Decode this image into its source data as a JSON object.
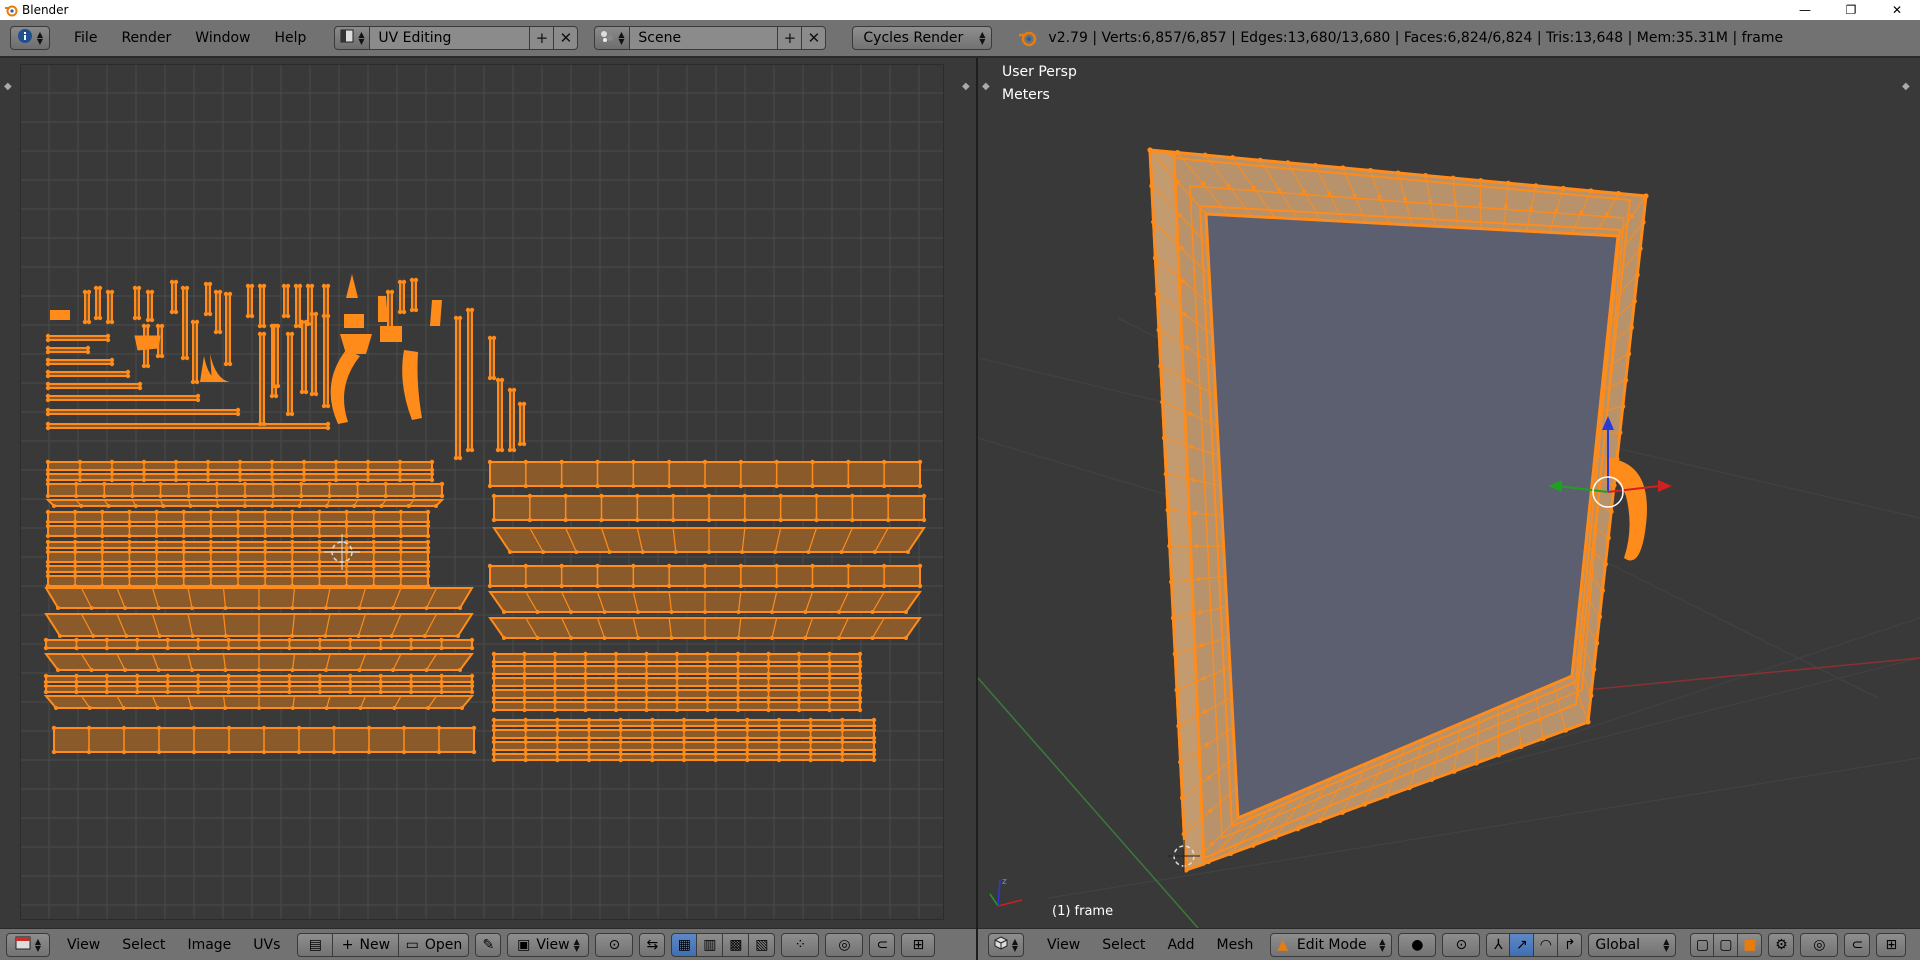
{
  "window": {
    "title": "Blender",
    "minimize": "—",
    "maximize": "❐",
    "close": "✕"
  },
  "info_header": {
    "menu": [
      "File",
      "Render",
      "Window",
      "Help"
    ],
    "screen_layout": "UV Editing",
    "scene": "Scene",
    "render_engine": "Cycles Render",
    "stats": "v2.79 | Verts:6,857/6,857 | Edges:13,680/13,680 | Faces:6,824/6,824 | Tris:13,648 | Mem:35.31M | frame",
    "add_symbol": "+",
    "close_symbol": "✕"
  },
  "viewport": {
    "perspective": "User Persp",
    "units": "Meters",
    "object_label": "(1) frame"
  },
  "uv_header": {
    "menu": [
      "View",
      "Select",
      "Image",
      "UVs"
    ],
    "new_label": "New",
    "open_label": "Open",
    "view_label": "View"
  },
  "view3d_header": {
    "menu": [
      "View",
      "Select",
      "Add",
      "Mesh"
    ],
    "mode": "Edit Mode",
    "orientation": "Global"
  },
  "colors": {
    "selection": "#ff8c1a",
    "background": "#393939",
    "header": "#727272",
    "face_fill": "#8a5a2a"
  },
  "icons": [
    "blender-logo-icon",
    "info-icon",
    "layout-icon",
    "scene-icon",
    "3d-view-icon",
    "image-editor-icon",
    "pin-icon",
    "gizmo-icon"
  ]
}
